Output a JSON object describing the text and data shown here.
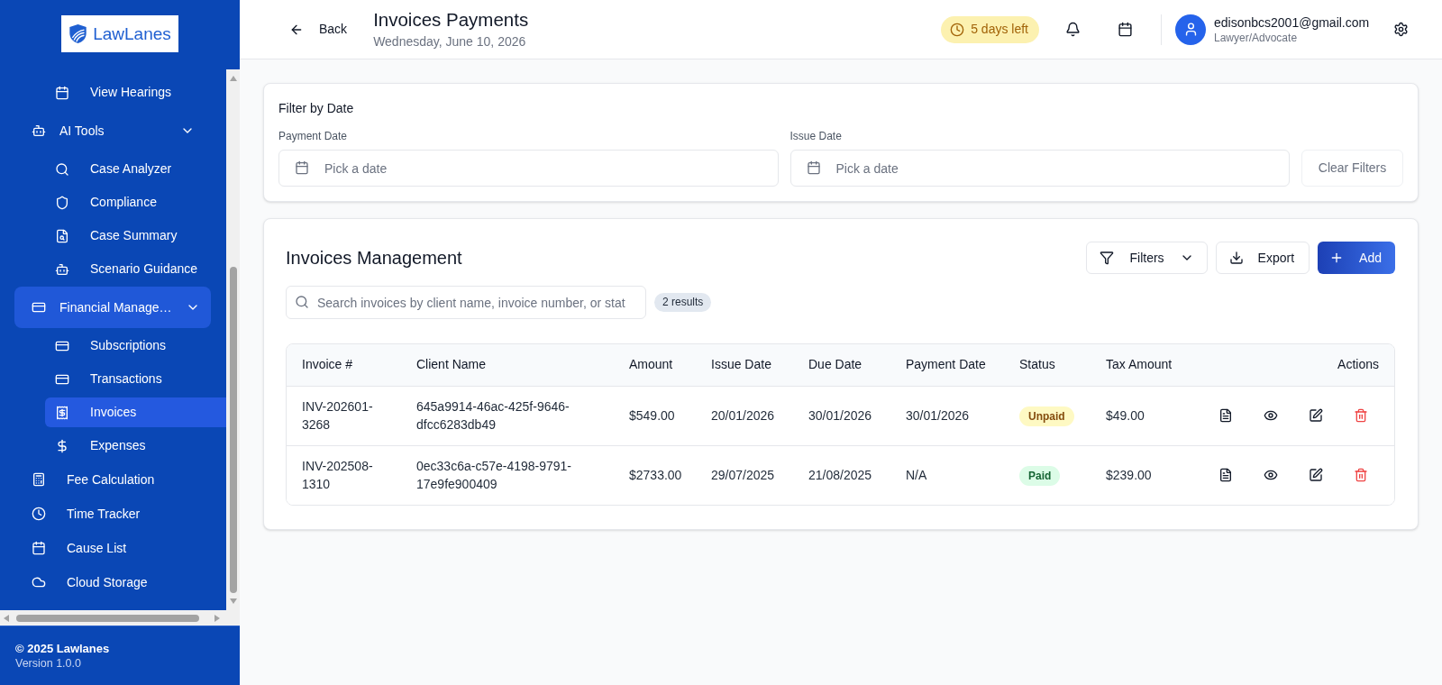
{
  "sidebar": {
    "logo": {
      "text": "LawLanes"
    },
    "items": [
      {
        "children": [
          {
            "label": "View Hearings",
            "selected": false
          }
        ]
      },
      {
        "label": "AI Tools",
        "selected": false,
        "expanded": true,
        "children": [
          {
            "label": "Case Analyzer",
            "selected": false
          },
          {
            "label": "Compliance",
            "selected": false
          },
          {
            "label": "Case Summary",
            "selected": false
          },
          {
            "label": "Scenario Guidance",
            "selected": false
          }
        ]
      },
      {
        "label": "Financial Manage…",
        "selected": true,
        "expanded": true,
        "children": [
          {
            "label": "Subscriptions",
            "selected": false
          },
          {
            "label": "Transactions",
            "selected": false
          },
          {
            "label": "Invoices",
            "selected": true
          },
          {
            "label": "Expenses",
            "selected": false
          }
        ]
      },
      {
        "label": "Fee Calculation",
        "selected": false
      },
      {
        "label": "Time Tracker",
        "selected": false
      },
      {
        "label": "Cause List",
        "selected": false
      },
      {
        "label": "Cloud Storage",
        "selected": false
      }
    ],
    "footer": {
      "copyright": "© 2025 Lawlanes",
      "version": "Version 1.0.0"
    }
  },
  "header": {
    "back": {
      "label": "Back"
    },
    "title": "Invoices Payments",
    "date": "Wednesday, June 10, 2026",
    "trial_badge": "5 days left",
    "user": {
      "email": "edisonbcs2001@gmail.com",
      "role": "Lawyer/Advocate"
    }
  },
  "filter_card": {
    "title": "Filter by Date",
    "fields": [
      {
        "label": "Payment Date",
        "placeholder": "Pick a date"
      },
      {
        "label": "Issue Date",
        "placeholder": "Pick a date"
      }
    ],
    "clear_button": {
      "label": "Clear Filters",
      "disabled": true
    }
  },
  "invoices_card": {
    "title": "Invoices Management",
    "buttons": [
      {
        "label": "Filters",
        "kind": "dropdown"
      },
      {
        "label": "Export",
        "kind": "outline"
      },
      {
        "label": "Add",
        "kind": "primary"
      }
    ],
    "search": {
      "placeholder": "Search invoices by client name, invoice number, or stat"
    },
    "results": "2 results",
    "table": {
      "columns": [
        "Invoice #",
        "Client Name",
        "Amount",
        "Issue Date",
        "Due Date",
        "Payment Date",
        "Status",
        "Tax Amount",
        "Actions"
      ],
      "rows": [
        {
          "invoice_number": "INV-202601-3268",
          "client_name": "645a9914-46ac-425f-9646-dfcc6283db49",
          "amount": "$549.00",
          "issue_date": "20/01/2026",
          "due_date": "30/01/2026",
          "payment_date": "30/01/2026",
          "status": {
            "label": "Unpaid",
            "kind": "unpaid"
          },
          "tax_amount": "$49.00"
        },
        {
          "invoice_number": "INV-202508-1310",
          "client_name": "0ec33c6a-c57e-4198-9791-17e9fe900409",
          "amount": "$2733.00",
          "issue_date": "29/07/2025",
          "due_date": "21/08/2025",
          "payment_date": "N/A",
          "status": {
            "label": "Paid",
            "kind": "paid"
          },
          "tax_amount": "$239.00"
        }
      ]
    }
  }
}
